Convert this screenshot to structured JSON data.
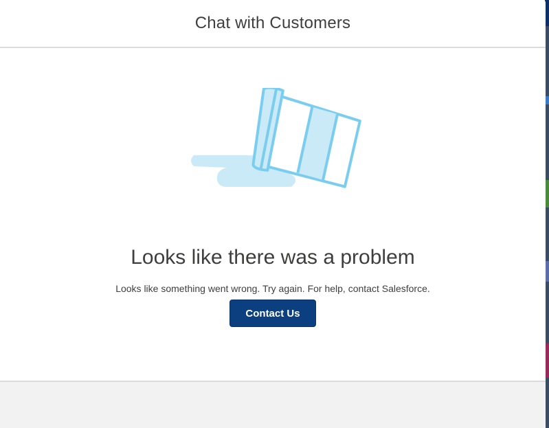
{
  "modal": {
    "title": "Chat with Customers",
    "error_heading": "Looks like there was a problem",
    "error_message": "Looks like something went wrong. Try again. For help, contact Salesforce.",
    "contact_button_label": "Contact Us",
    "illustration_icon": "spilled-cup-illustration"
  },
  "colors": {
    "button_bg": "#0b3f80",
    "illustration_stroke": "#7bcdf0",
    "illustration_fill": "#cbeaf8"
  }
}
